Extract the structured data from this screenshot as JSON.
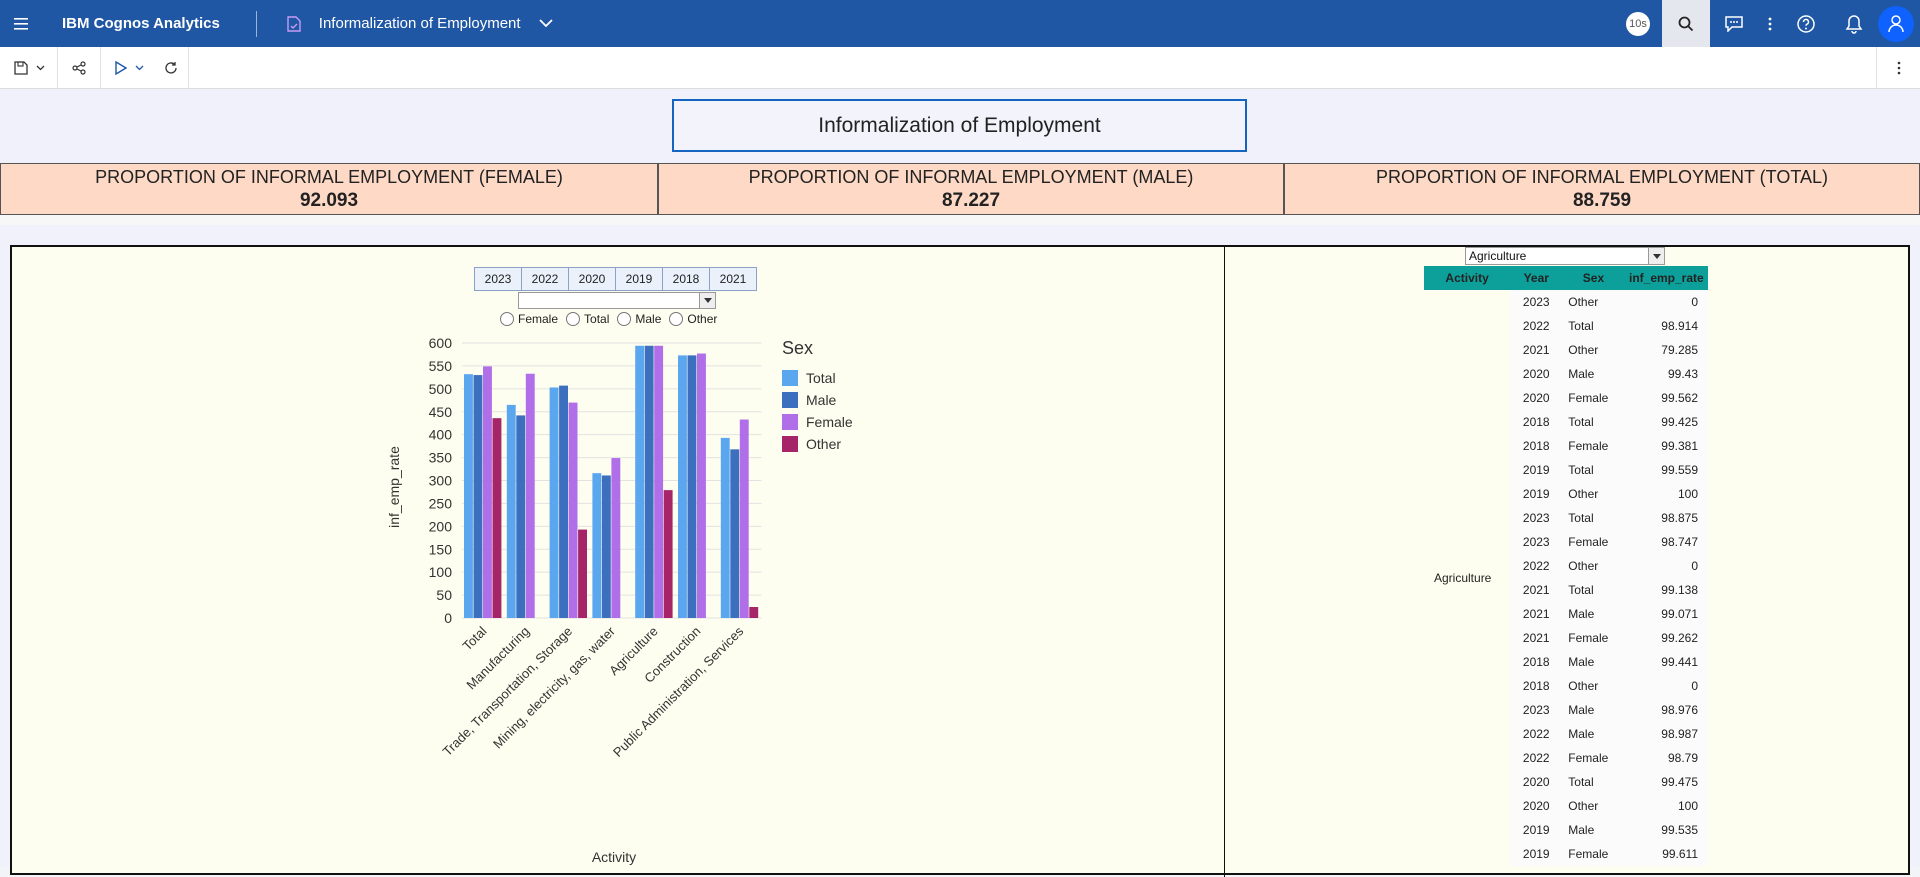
{
  "app": {
    "brand": "IBM Cognos Analytics",
    "doc_title": "Informalization of Employment",
    "badge": "10s"
  },
  "report": {
    "title": "Informalization of Employment"
  },
  "kpis": [
    {
      "label": "PROPORTION OF INFORMAL EMPLOYMENT (FEMALE)",
      "value": "92.093"
    },
    {
      "label": "PROPORTION OF INFORMAL EMPLOYMENT (MALE)",
      "value": "87.227"
    },
    {
      "label": "PROPORTION OF INFORMAL EMPLOYMENT (TOTAL)",
      "value": "88.759"
    }
  ],
  "filters": {
    "years": [
      "2023",
      "2022",
      "2020",
      "2019",
      "2018",
      "2021"
    ],
    "sex_options": [
      "Female",
      "Total",
      "Male",
      "Other"
    ],
    "activity_select": "Agriculture"
  },
  "colors": {
    "total": "#5aa7f0",
    "male": "#3d6fbf",
    "female": "#b06ee8",
    "other": "#a62568",
    "table_header": "#0da09a",
    "topbar": "#1f57a4"
  },
  "chart_data": {
    "type": "bar",
    "xlabel": "Activity",
    "ylabel": "inf_emp_rate",
    "legend_title": "Sex",
    "legend_position": "right",
    "ylim": [
      0,
      600
    ],
    "yticks": [
      0,
      50,
      100,
      150,
      200,
      250,
      300,
      350,
      400,
      450,
      500,
      550,
      600
    ],
    "categories": [
      "Total",
      "Manufacturing",
      "Trade, Transportation, Storage",
      "Mining, electricity, gas, water",
      "Agriculture",
      "Construction",
      "Public Administration, Services"
    ],
    "series": [
      {
        "name": "Total",
        "values": [
          532,
          465,
          503,
          316,
          594,
          573,
          393
        ]
      },
      {
        "name": "Male",
        "values": [
          530,
          442,
          507,
          311,
          594,
          573,
          368
        ]
      },
      {
        "name": "Female",
        "values": [
          549,
          533,
          470,
          349,
          594,
          577,
          433
        ]
      },
      {
        "name": "Other",
        "values": [
          436,
          0,
          193,
          0,
          279,
          0,
          24
        ]
      }
    ]
  },
  "table": {
    "headers": [
      "Activity",
      "Year",
      "Sex",
      "inf_emp_rate"
    ],
    "activity": "Agriculture",
    "rows": [
      [
        "2023",
        "Other",
        "0"
      ],
      [
        "2022",
        "Total",
        "98.914"
      ],
      [
        "2021",
        "Other",
        "79.285"
      ],
      [
        "2020",
        "Male",
        "99.43"
      ],
      [
        "2020",
        "Female",
        "99.562"
      ],
      [
        "2018",
        "Total",
        "99.425"
      ],
      [
        "2018",
        "Female",
        "99.381"
      ],
      [
        "2019",
        "Total",
        "99.559"
      ],
      [
        "2019",
        "Other",
        "100"
      ],
      [
        "2023",
        "Total",
        "98.875"
      ],
      [
        "2023",
        "Female",
        "98.747"
      ],
      [
        "2022",
        "Other",
        "0"
      ],
      [
        "2021",
        "Total",
        "99.138"
      ],
      [
        "2021",
        "Male",
        "99.071"
      ],
      [
        "2021",
        "Female",
        "99.262"
      ],
      [
        "2018",
        "Male",
        "99.441"
      ],
      [
        "2018",
        "Other",
        "0"
      ],
      [
        "2023",
        "Male",
        "98.976"
      ],
      [
        "2022",
        "Male",
        "98.987"
      ],
      [
        "2022",
        "Female",
        "98.79"
      ],
      [
        "2020",
        "Total",
        "99.475"
      ],
      [
        "2020",
        "Other",
        "100"
      ],
      [
        "2019",
        "Male",
        "99.535"
      ],
      [
        "2019",
        "Female",
        "99.611"
      ]
    ]
  }
}
